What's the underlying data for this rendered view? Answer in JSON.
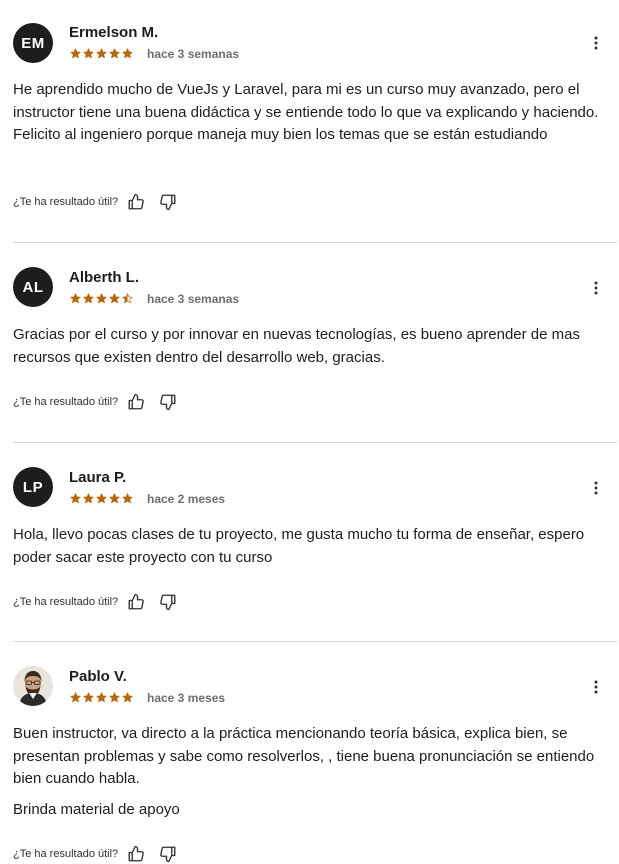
{
  "colors": {
    "star": "#b4690e",
    "text": "#1c1d1f",
    "muted": "#6a6f73",
    "divider": "#d1d7dc"
  },
  "helpful_label": "¿Te ha resultado útil?",
  "reviews": [
    {
      "initials": "EM",
      "name": "Ermelson M.",
      "rating": 5,
      "date": "hace 3 semanas",
      "text": [
        "He aprendido mucho de VueJs y Laravel, para mi es un curso muy avanzado, pero el instructor tiene una buena didáctica y se entiende todo lo que va explicando y haciendo. Felicito al ingeniero porque maneja muy bien los temas que se están estudiando"
      ]
    },
    {
      "initials": "AL",
      "name": "Alberth L.",
      "rating": 4.5,
      "date": "hace 3 semanas",
      "text": [
        "Gracias por el curso y por innovar en nuevas tecnologías, es bueno aprender de mas recursos que existen dentro del desarrollo web, gracias."
      ]
    },
    {
      "initials": "LP",
      "name": "Laura P.",
      "rating": 5,
      "date": "hace 2 meses",
      "text": [
        "Hola, llevo pocas clases de tu proyecto, me gusta mucho tu forma de enseñar, espero poder sacar este proyecto con tu curso"
      ]
    },
    {
      "initials": "",
      "avatar_icon": "user-photo-avatar",
      "name": "Pablo V.",
      "rating": 5,
      "date": "hace 3 meses",
      "text": [
        "Buen instructor, va directo a la práctica mencionando teoría básica, explica bien, se presentan problemas y sabe como resolverlos, , tiene buena pronunciación se entiendo bien cuando habla.",
        "Brinda material de apoyo"
      ]
    }
  ]
}
